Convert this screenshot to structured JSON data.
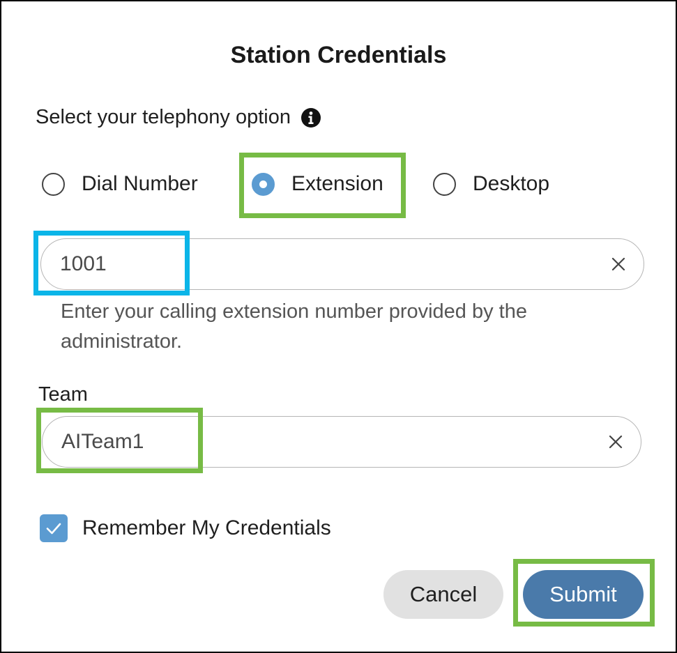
{
  "dialog": {
    "title": "Station Credentials",
    "prompt": "Select your telephony option"
  },
  "telephony_options": [
    {
      "label": "Dial Number",
      "selected": false
    },
    {
      "label": "Extension",
      "selected": true
    },
    {
      "label": "Desktop",
      "selected": false
    }
  ],
  "extension_field": {
    "value": "1001",
    "helper_text": "Enter your calling extension number provided by the administrator."
  },
  "team": {
    "label": "Team",
    "value": "AITeam1"
  },
  "remember": {
    "label": "Remember My Credentials",
    "checked": true
  },
  "buttons": {
    "cancel": "Cancel",
    "submit": "Submit"
  },
  "colors": {
    "accent": "#5b9bd1",
    "submit": "#4a7aaa",
    "highlight_green": "#77bb45",
    "highlight_blue": "#0bb5e8"
  },
  "icons": {
    "info": "info-icon",
    "clear": "close-icon",
    "check": "checkmark-icon"
  }
}
